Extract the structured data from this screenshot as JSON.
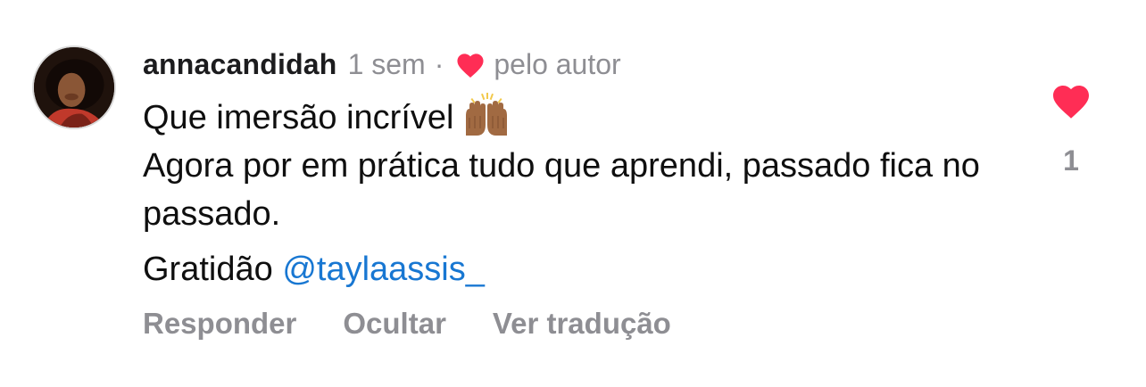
{
  "comment": {
    "username": "annacandidah",
    "time": "1 sem",
    "separator": "·",
    "liked_by_author_label": "pelo autor",
    "lines": {
      "line1": "Que imersão incrível",
      "line2": "Agora por em prática tudo que aprendi, passado fica no passado.",
      "line3_prefix": "Gratidão ",
      "mention": "@taylaassis_"
    },
    "emoji_icon": "raising-hands-emoji",
    "like_count": "1"
  },
  "actions": {
    "reply": "Responder",
    "hide": "Ocultar",
    "translate": "Ver tradução"
  },
  "colors": {
    "heart_red": "#ff2d55",
    "muted_gray": "#8e8e93",
    "mention_blue": "#1877d2"
  }
}
